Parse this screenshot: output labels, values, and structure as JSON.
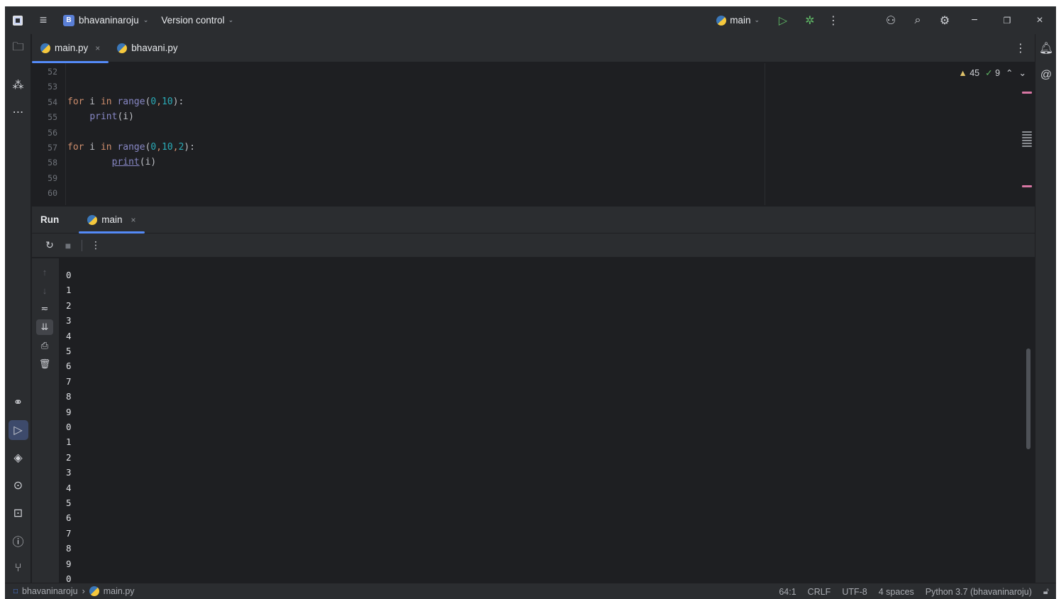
{
  "titlebar": {
    "project_letter": "B",
    "project_name": "bhavaninaroju",
    "vcs_label": "Version control",
    "run_config": "main"
  },
  "editor": {
    "tabs": [
      {
        "label": "main.py",
        "active": true
      },
      {
        "label": "bhavani.py",
        "active": false
      }
    ],
    "line_numbers": [
      "52",
      "53",
      "54",
      "55",
      "56",
      "57",
      "58",
      "59",
      "60"
    ],
    "code": {
      "l54_kw1": "for",
      "l54_var": " i ",
      "l54_kw2": "in",
      "l54_fn": " range",
      "l54_open": "(",
      "l54_a": "0",
      "l54_comma": ",",
      "l54_b": "10",
      "l54_close": "):",
      "l55_indent": "    ",
      "l55_fn": "print",
      "l55_arg": "(i)",
      "l57_kw1": "for",
      "l57_var": " i ",
      "l57_kw2": "in",
      "l57_fn": " range",
      "l57_open": "(",
      "l57_a": "0",
      "l57_comma1": ",",
      "l57_b": "10",
      "l57_comma2": ",",
      "l57_c": "2",
      "l57_close": "):",
      "l58_indent": "        ",
      "l58_fn": "print",
      "l58_arg": "(i)"
    },
    "inspections": {
      "warnings": "45",
      "weak_warnings": "9"
    }
  },
  "run_panel": {
    "title": "Run",
    "tab_label": "main",
    "output": [
      "0",
      "1",
      "2",
      "3",
      "4",
      "5",
      "6",
      "7",
      "8",
      "9",
      "0",
      "1",
      "2",
      "3",
      "4",
      "5",
      "6",
      "7",
      "8",
      "9",
      "0"
    ]
  },
  "statusbar": {
    "project": "bhavaninaroju",
    "separator": "›",
    "file": "main.py",
    "position": "64:1",
    "line_sep": "CRLF",
    "encoding": "UTF-8",
    "indent": "4 spaces",
    "interpreter": "Python 3.7 (bhavaninaroju)"
  },
  "colors": {
    "background": "#1e1f22",
    "panel": "#2b2d30",
    "accent": "#548af7",
    "keyword": "#cf8e6d",
    "builtin": "#8888c6",
    "number": "#2aacb8"
  },
  "icons": [
    "app-logo-icon",
    "main-menu-icon",
    "run-icon",
    "debug-icon",
    "more-icon",
    "add-user-icon",
    "search-icon",
    "settings-icon",
    "minimize-icon",
    "restore-icon",
    "close-icon",
    "folder-icon",
    "structure-icon",
    "python-console-icon",
    "run-tool-icon",
    "python-packages-icon",
    "services-icon",
    "terminal-icon",
    "problems-icon",
    "git-icon",
    "notifications-icon",
    "ai-assistant-icon",
    "rerun-icon",
    "stop-icon"
  ]
}
